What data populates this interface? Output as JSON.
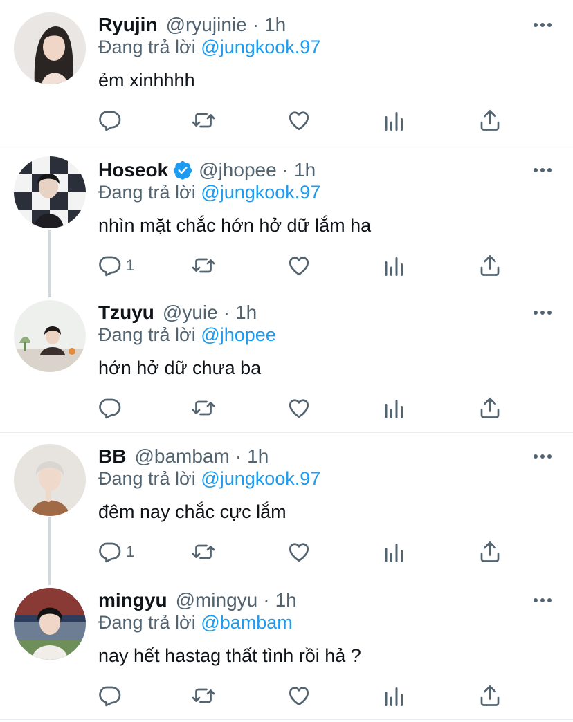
{
  "tweets": [
    {
      "name": "Ryujin",
      "handle": "@ryujinie",
      "time": "1h",
      "replying_prefix": "Đang trả lời",
      "replying_to": "@jungkook.97",
      "text": "ẻm xinhhhh",
      "verified": false,
      "reply_count": "",
      "avatar_icon": "woman-portrait-avatar"
    },
    {
      "name": "Hoseok",
      "handle": "@jhopee",
      "time": "1h",
      "replying_prefix": "Đang trả lời",
      "replying_to": "@jungkook.97",
      "text": "nhìn mặt chắc hớn hở dữ lắm ha",
      "verified": true,
      "reply_count": "1",
      "avatar_icon": "checkered-portrait-avatar"
    },
    {
      "name": "Tzuyu",
      "handle": "@yuie",
      "time": "1h",
      "replying_prefix": "Đang trả lời",
      "replying_to": "@jhopee",
      "text": "hớn hở dữ chưa ba",
      "verified": false,
      "reply_count": "",
      "avatar_icon": "woman-at-table-avatar"
    },
    {
      "name": "BB",
      "handle": "@bambam",
      "time": "1h",
      "replying_prefix": "Đang trả lời",
      "replying_to": "@jungkook.97",
      "text": "đêm nay chắc cực lắm",
      "verified": false,
      "reply_count": "1",
      "avatar_icon": "person-hand-on-chin-avatar"
    },
    {
      "name": "mingyu",
      "handle": "@mingyu",
      "time": "1h",
      "replying_prefix": "Đang trả lời",
      "replying_to": "@bambam",
      "text": "nay hết hastag thất tình rồi hả ?",
      "verified": false,
      "reply_count": "",
      "avatar_icon": "man-at-stadium-avatar"
    }
  ],
  "separator": "·",
  "colors": {
    "link": "#1d9bf0",
    "secondary_text": "#536471",
    "primary_text": "#0f1419",
    "divider": "#e6ecf0",
    "thread_line": "#cfd9de"
  }
}
